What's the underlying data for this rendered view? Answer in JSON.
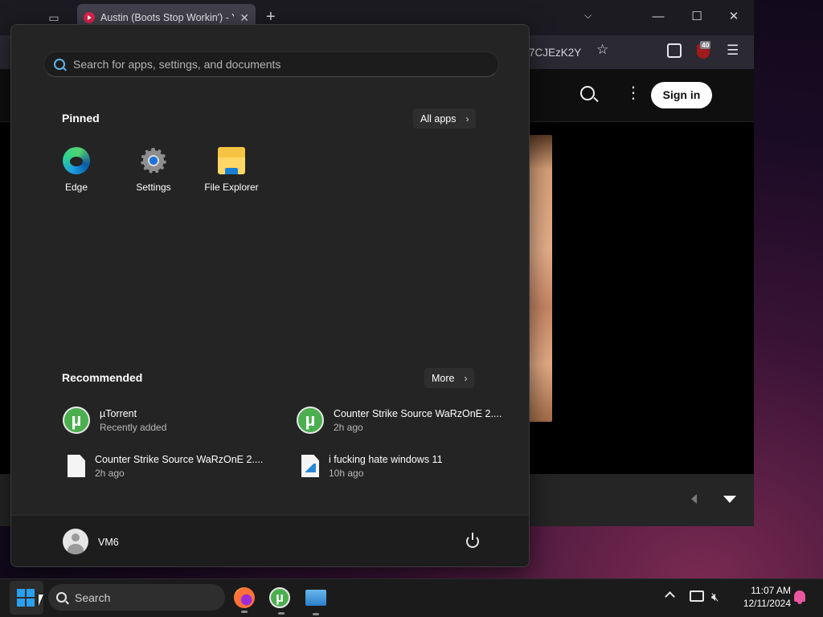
{
  "browser": {
    "tab_title": "Austin (Boots Stop Workin') - Yo",
    "tab_close": "✕",
    "new_tab": "+",
    "url_fragment": "7CJEzK2Y",
    "extension_badge": "40",
    "youtube": {
      "sign_in": "Sign in"
    }
  },
  "start_menu": {
    "search_placeholder": "Search for apps, settings, and documents",
    "pinned_title": "Pinned",
    "all_apps": "All apps",
    "pinned": [
      {
        "label": "Edge",
        "icon": "edge-icon"
      },
      {
        "label": "Settings",
        "icon": "settings-icon"
      },
      {
        "label": "File Explorer",
        "icon": "file-explorer-icon"
      }
    ],
    "recommended_title": "Recommended",
    "more": "More",
    "recommended": [
      {
        "name": "µTorrent",
        "sub": "Recently added",
        "icon": "utorrent-icon"
      },
      {
        "name": "Counter Strike Source WaRzOnE 2....",
        "sub": "2h ago",
        "icon": "utorrent-icon"
      },
      {
        "name": "Counter Strike Source WaRzOnE 2....",
        "sub": "2h ago",
        "icon": "file-icon"
      },
      {
        "name": "i fucking hate windows 11",
        "sub": "10h ago",
        "icon": "image-file-icon"
      }
    ],
    "user": "VM6"
  },
  "taskbar": {
    "search_label": "Search",
    "apps": [
      "firefox-icon",
      "utorrent-icon",
      "remote-desktop-icon"
    ],
    "time": "11:07 AM",
    "date": "12/11/2024"
  },
  "colors": {
    "accent": "#2aa0f0",
    "utorrent_green": "#4caf4f",
    "notification": "#e9579f"
  }
}
